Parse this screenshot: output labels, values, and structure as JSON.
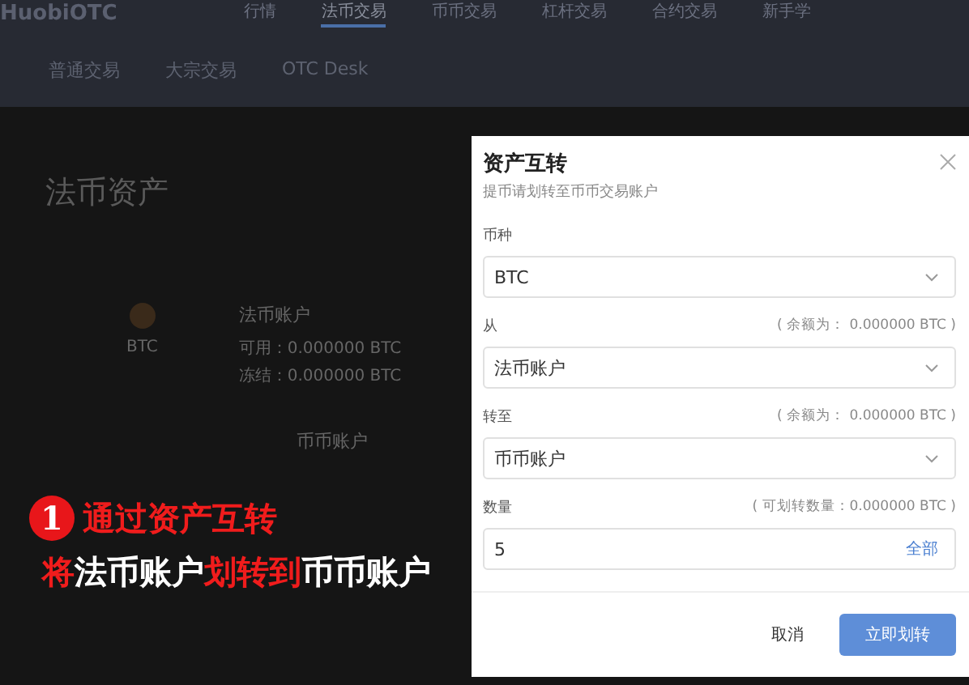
{
  "nav": {
    "logo": "HuobiOTC",
    "items": [
      {
        "label": "行情",
        "selected": false
      },
      {
        "label": "法币交易",
        "selected": true
      },
      {
        "label": "币币交易",
        "selected": false
      },
      {
        "label": "杠杆交易",
        "selected": false
      },
      {
        "label": "合约交易",
        "selected": false
      },
      {
        "label": "新手学",
        "selected": false
      }
    ]
  },
  "subnav": [
    {
      "label": "普通交易"
    },
    {
      "label": "大宗交易"
    },
    {
      "label": "OTC Desk"
    }
  ],
  "page": {
    "title": "法币资产",
    "coin": "BTC",
    "account": "法币账户",
    "lines": [
      "可用：0.000000 BTC",
      "冻结：0.000000 BTC"
    ],
    "second_account": "币币账户"
  },
  "annotation": {
    "number": "1",
    "title": "通过资产互转",
    "line": [
      {
        "text": "将",
        "accent": true
      },
      {
        "text": "法币账户",
        "accent": false
      },
      {
        "text": "划转到",
        "accent": true
      },
      {
        "text": "币币账户",
        "accent": false
      }
    ]
  },
  "dialog": {
    "title": "资产互转",
    "subtitle": "提币请划转至币币交易账户",
    "fields": [
      {
        "kind": "select",
        "label": "币种",
        "value": "BTC"
      },
      {
        "kind": "select",
        "label": "从",
        "note": "( 余额为：  0.000000 BTC )",
        "value": "法币账户"
      },
      {
        "kind": "select",
        "label": "转至",
        "note": "( 余额为：  0.000000 BTC )",
        "value": "币币账户"
      },
      {
        "kind": "input",
        "label": "数量",
        "note": "( 可划转数量：0.000000 BTC )",
        "value": "5",
        "action": "全部"
      }
    ],
    "cancel": "取消",
    "confirm": "立即划转"
  }
}
